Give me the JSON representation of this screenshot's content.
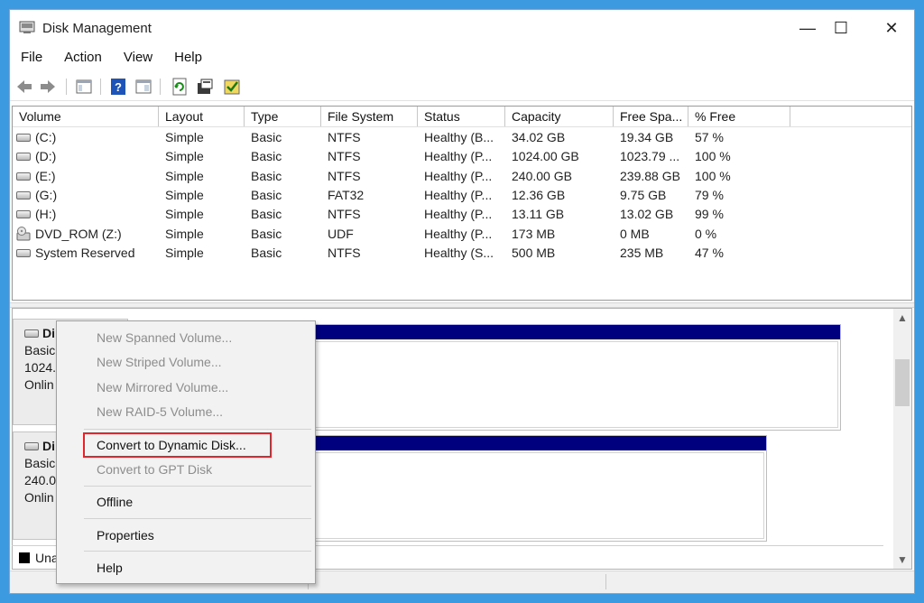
{
  "window": {
    "title": "Disk Management",
    "minimize_glyph": "—",
    "maximize_glyph": "☐",
    "close_glyph": "✕"
  },
  "menubar": {
    "items": [
      {
        "label": "File"
      },
      {
        "label": "Action"
      },
      {
        "label": "View"
      },
      {
        "label": "Help"
      }
    ]
  },
  "toolbar": {
    "icons": [
      "back-arrow-icon",
      "forward-arrow-icon",
      "console-tree-icon",
      "help-icon",
      "show-pane-icon",
      "refresh-icon",
      "properties-icon",
      "check-disk-icon"
    ]
  },
  "volume_table": {
    "columns": [
      "Volume",
      "Layout",
      "Type",
      "File System",
      "Status",
      "Capacity",
      "Free Spa...",
      "% Free"
    ],
    "rows": [
      {
        "volume": "(C:)",
        "layout": "Simple",
        "type": "Basic",
        "fs": "NTFS",
        "status": "Healthy (B...",
        "capacity": "34.02 GB",
        "free": "19.34 GB",
        "pct": "57 %",
        "icon": "drive-icon"
      },
      {
        "volume": "(D:)",
        "layout": "Simple",
        "type": "Basic",
        "fs": "NTFS",
        "status": "Healthy (P...",
        "capacity": "1024.00 GB",
        "free": "1023.79 ...",
        "pct": "100 %",
        "icon": "drive-icon"
      },
      {
        "volume": "(E:)",
        "layout": "Simple",
        "type": "Basic",
        "fs": "NTFS",
        "status": "Healthy (P...",
        "capacity": "240.00 GB",
        "free": "239.88 GB",
        "pct": "100 %",
        "icon": "drive-icon"
      },
      {
        "volume": "(G:)",
        "layout": "Simple",
        "type": "Basic",
        "fs": "FAT32",
        "status": "Healthy (P...",
        "capacity": "12.36 GB",
        "free": "9.75 GB",
        "pct": "79 %",
        "icon": "drive-icon"
      },
      {
        "volume": "(H:)",
        "layout": "Simple",
        "type": "Basic",
        "fs": "NTFS",
        "status": "Healthy (P...",
        "capacity": "13.11 GB",
        "free": "13.02 GB",
        "pct": "99 %",
        "icon": "drive-icon"
      },
      {
        "volume": "DVD_ROM (Z:)",
        "layout": "Simple",
        "type": "Basic",
        "fs": "UDF",
        "status": "Healthy (P...",
        "capacity": "173 MB",
        "free": "0 MB",
        "pct": "0 %",
        "icon": "dvd-icon"
      },
      {
        "volume": "System Reserved",
        "layout": "Simple",
        "type": "Basic",
        "fs": "NTFS",
        "status": "Healthy (S...",
        "capacity": "500 MB",
        "free": "235 MB",
        "pct": "47 %",
        "icon": "drive-icon"
      }
    ]
  },
  "disks": [
    {
      "name": "Di",
      "type": "Basic",
      "size": "1024.0",
      "status": "Onlin"
    },
    {
      "name": "Di",
      "type": "Basic",
      "size": "240.00",
      "status": "Onlin"
    }
  ],
  "legend": {
    "label": "Una"
  },
  "context_menu": {
    "items": [
      {
        "label": "New Spanned Volume...",
        "enabled": false
      },
      {
        "label": "New Striped Volume...",
        "enabled": false
      },
      {
        "label": "New Mirrored Volume...",
        "enabled": false
      },
      {
        "label": "New RAID-5 Volume...",
        "enabled": false
      },
      {
        "label": "Convert to Dynamic Disk...",
        "enabled": true,
        "highlighted": true
      },
      {
        "label": "Convert to GPT Disk",
        "enabled": false
      },
      {
        "label": "Offline",
        "enabled": true
      },
      {
        "label": "Properties",
        "enabled": true
      },
      {
        "label": "Help",
        "enabled": true
      }
    ]
  },
  "colors": {
    "frame": "#3c9be0",
    "partition_bar": "#00007f",
    "highlight": "#e0252c"
  }
}
